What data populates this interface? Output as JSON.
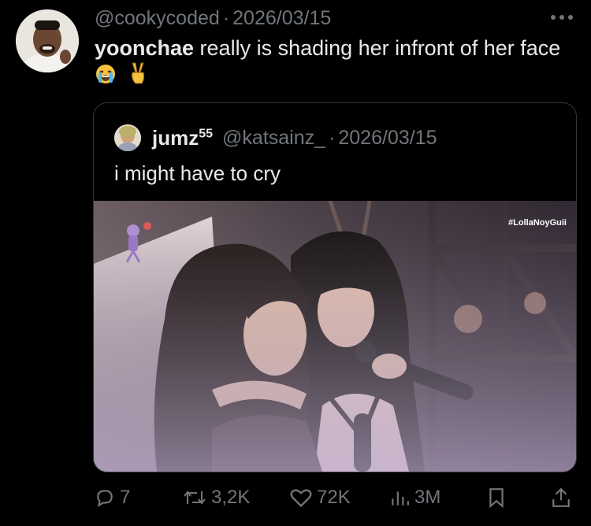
{
  "tweet": {
    "handle": "@cookycoded",
    "separator": "·",
    "date": "2026/03/15",
    "text_bold": "yoonchae",
    "text_rest": " really is shading her infront of her face"
  },
  "quote": {
    "name": "jumz",
    "name_sup": "55",
    "handle": "@katsainz_",
    "separator": "·",
    "date": "2026/03/15",
    "text": "i might have to cry",
    "media_hashtag": "#LollaNoyGuii"
  },
  "actions": {
    "replies": "7",
    "reposts": "3,2K",
    "likes": "72K",
    "views": "3M"
  },
  "icons": {
    "more": "more-horizontal-icon",
    "reply": "reply-icon",
    "repost": "repost-icon",
    "like": "heart-icon",
    "views": "views-chart-icon",
    "bookmark": "bookmark-icon",
    "share": "share-icon"
  },
  "colors": {
    "background": "#000000",
    "primary_text": "#e7e9ea",
    "secondary_text": "#71767b",
    "border": "#333639"
  }
}
